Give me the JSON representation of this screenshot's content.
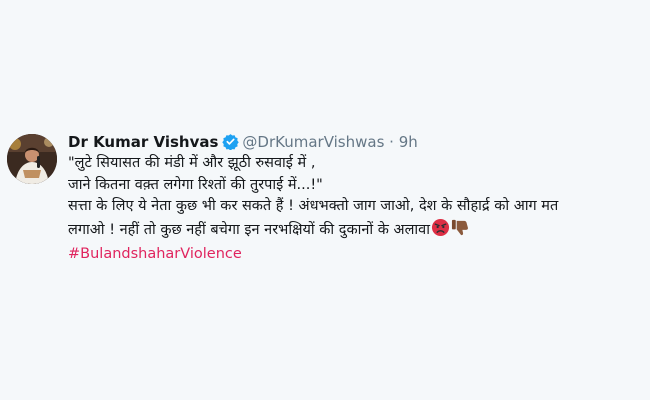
{
  "tweet": {
    "author_name": "Dr Kumar Vishvas",
    "author_handle": "@DrKumarVishwas",
    "separator": "·",
    "time": "9h",
    "lines": [
      "\"लुटे सियासत की मंडी में और झूठी रुसवाई में ,",
      "जाने कितना वक़्त लगेगा रिश्तों की तुरपाई में...!\"",
      "सत्ता के लिए ये नेता कुछ भी कर सकते हैं ! अंधभक्तो जाग जाओ, देश के सौहार्द्र को आग मत",
      "लगाओ ! नहीं तो कुछ नहीं बचेगा इन नरभक्षियों की दुकानों के अलावा"
    ],
    "emojis": [
      "angry-face-icon",
      "thumbs-down-icon"
    ],
    "hashtag": "#BulandshaharViolence"
  },
  "colors": {
    "background": "#f5f8fa",
    "text": "#14171a",
    "muted": "#657786",
    "verified": "#1da1f2",
    "hashtag": "#e0245e"
  }
}
